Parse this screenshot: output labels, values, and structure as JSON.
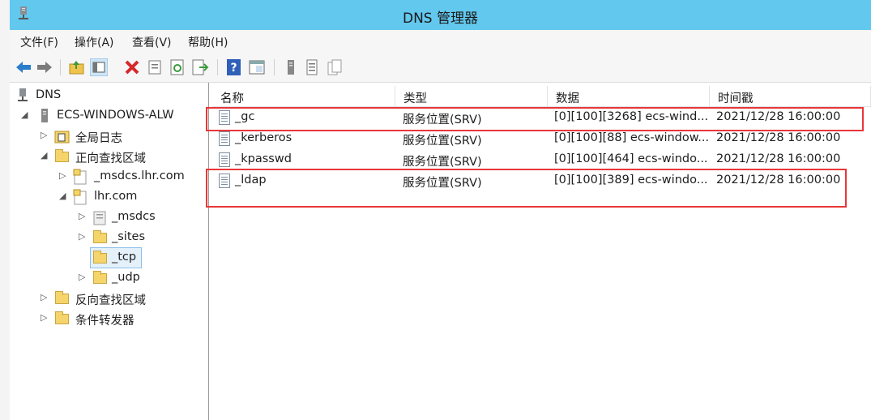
{
  "window": {
    "title": "DNS 管理器"
  },
  "menu": [
    "文件(F)",
    "操作(A)",
    "查看(V)",
    "帮助(H)"
  ],
  "toolbar": {
    "buttons": [
      "back-icon",
      "forward-icon",
      "up-folder-icon",
      "show-hide-tree-icon",
      "delete-icon",
      "properties-icon",
      "refresh-icon",
      "export-list-icon",
      "help-icon",
      "console-icon",
      "server-icon",
      "record-list-icon",
      "record-copy-icon"
    ]
  },
  "tree": {
    "root": "DNS",
    "server": "ECS-WINDOWS-ALW",
    "global_logs": "全局日志",
    "forward_zones": "正向查找区域",
    "msdcs_zone": "_msdcs.lhr.com",
    "lhr_zone": "lhr.com",
    "sub_msdcs": "_msdcs",
    "sub_sites": "_sites",
    "sub_tcp": "_tcp",
    "sub_udp": "_udp",
    "reverse_zones": "反向查找区域",
    "forwarders": "条件转发器"
  },
  "list": {
    "columns": [
      "名称",
      "类型",
      "数据",
      "时间戳"
    ],
    "rows": [
      [
        "_gc",
        "服务位置(SRV)",
        "[0][100][3268] ecs-wind...",
        "2021/12/28 16:00:00"
      ],
      [
        "_kerberos",
        "服务位置(SRV)",
        "[0][100][88] ecs-window...",
        "2021/12/28 16:00:00"
      ],
      [
        "_kpasswd",
        "服务位置(SRV)",
        "[0][100][464] ecs-windo...",
        "2021/12/28 16:00:00"
      ],
      [
        "_ldap",
        "服务位置(SRV)",
        "[0][100][389] ecs-windo...",
        "2021/12/28 16:00:00"
      ]
    ]
  },
  "colors": {
    "titlebar": "#62c8ee",
    "highlight": "#e8373a",
    "selection": "#e4f1fb"
  }
}
